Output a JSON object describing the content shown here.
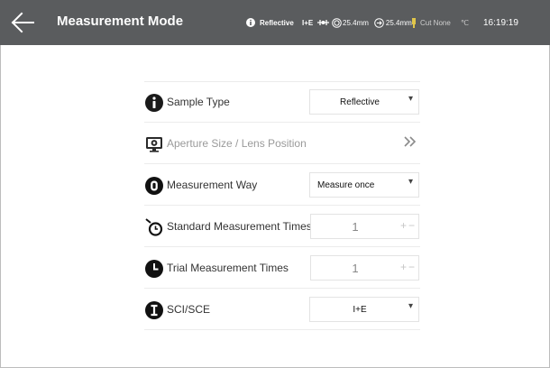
{
  "header": {
    "title": "Measurement Mode",
    "status": {
      "sample_type": "Reflective",
      "sci_sce": "I+E",
      "aperture_1": "25.4mm",
      "aperture_2": "25.4mm",
      "cut": "Cut None",
      "temperature_unit": "℃",
      "time": "16:19:19"
    }
  },
  "settings": [
    {
      "label": "Sample Type",
      "value": "Reflective",
      "icon": "info-icon",
      "control": "select"
    },
    {
      "label": "Aperture Size / Lens Position",
      "icon": "aperture-lens-icon",
      "control": "link",
      "disabled": true
    },
    {
      "label": "Measurement Way",
      "value": "Measure once",
      "icon": "measure-way-icon",
      "control": "select"
    },
    {
      "label": "Standard Measurement Times",
      "value": "1",
      "icon": "timer-icon",
      "control": "stepper"
    },
    {
      "label": "Trial Measurement Times",
      "value": "1",
      "icon": "clock-icon",
      "control": "stepper"
    },
    {
      "label": "SCI/SCE",
      "value": "I+E",
      "icon": "sci-sce-icon",
      "control": "select"
    }
  ],
  "controls": {
    "caret": "▾",
    "plus": "+",
    "minus": "−"
  },
  "colors": {
    "header_bg": "#5a5c5e",
    "divider": "#ececec"
  }
}
